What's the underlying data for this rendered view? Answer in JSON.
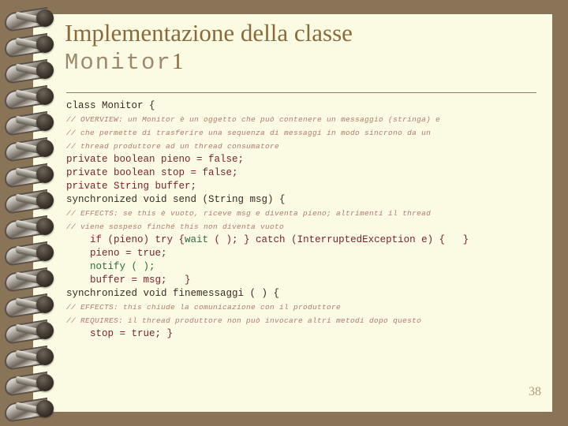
{
  "slide": {
    "title_main": "Implementazione della classe",
    "title_mono": "Monitor",
    "title_num": "1",
    "page_number": "38",
    "colors": {
      "background": "#8a7458",
      "page": "#fbfbe3",
      "title": "#8a6a3a",
      "title_mono": "#9c8a6e",
      "code": "#7a2230",
      "code_dark": "#3a2a24",
      "code_green": "#2f6b36",
      "comment": "#b07a6a",
      "rule": "#8a7a5e",
      "page_number": "#b09a78"
    }
  },
  "code": {
    "lines": [
      {
        "text": "class Monitor {",
        "style": "dark",
        "indent": 0
      },
      {
        "text": "// OVERVIEW: un Monitor è un oggetto che può contenere un messaggio (stringa) e",
        "style": "cmt",
        "indent": 0
      },
      {
        "text": "// che permette di trasferire una sequenza di messaggi in modo sincrono da un",
        "style": "cmt",
        "indent": 0
      },
      {
        "text": "// thread produttore ad un thread consumatore",
        "style": "cmt",
        "indent": 0
      },
      {
        "text": "private boolean pieno = false;",
        "style": "code",
        "indent": 0
      },
      {
        "text": "private boolean stop = false;",
        "style": "code",
        "indent": 0
      },
      {
        "text": "private String buffer;",
        "style": "code",
        "indent": 0
      },
      {
        "text": "synchronized void send (String msg) {",
        "style": "dark",
        "indent": 0
      },
      {
        "text": "// EFFECTS: se this è vuoto, riceve msg e diventa pieno; altrimenti il thread",
        "style": "cmt",
        "indent": 0
      },
      {
        "text": "// viene sospeso finché this non diventa vuoto",
        "style": "cmt",
        "indent": 0
      },
      {
        "text": "    if (pieno) try {wait ( ); } catch (InterruptedException e) {   }",
        "style": "code",
        "indent": 0
      },
      {
        "text": "    pieno = true;",
        "style": "code",
        "indent": 0
      },
      {
        "text": "    notify ( );",
        "style": "green",
        "indent": 0
      },
      {
        "text": "    buffer = msg;   }",
        "style": "code",
        "indent": 0
      },
      {
        "text": "synchronized void finemessaggi ( ) {",
        "style": "dark",
        "indent": 0
      },
      {
        "text": "// EFFECTS: this chiude la comunicazione con il produttore",
        "style": "cmt",
        "indent": 0
      },
      {
        "text": "// REQUIRES: il thread produttore non può invocare altri metodi dopo questo",
        "style": "cmt",
        "indent": 0
      },
      {
        "text": "    stop = true; }",
        "style": "code",
        "indent": 0
      }
    ]
  },
  "spiral": {
    "ring_count": 16,
    "icon": "spiral-binding-ring"
  }
}
